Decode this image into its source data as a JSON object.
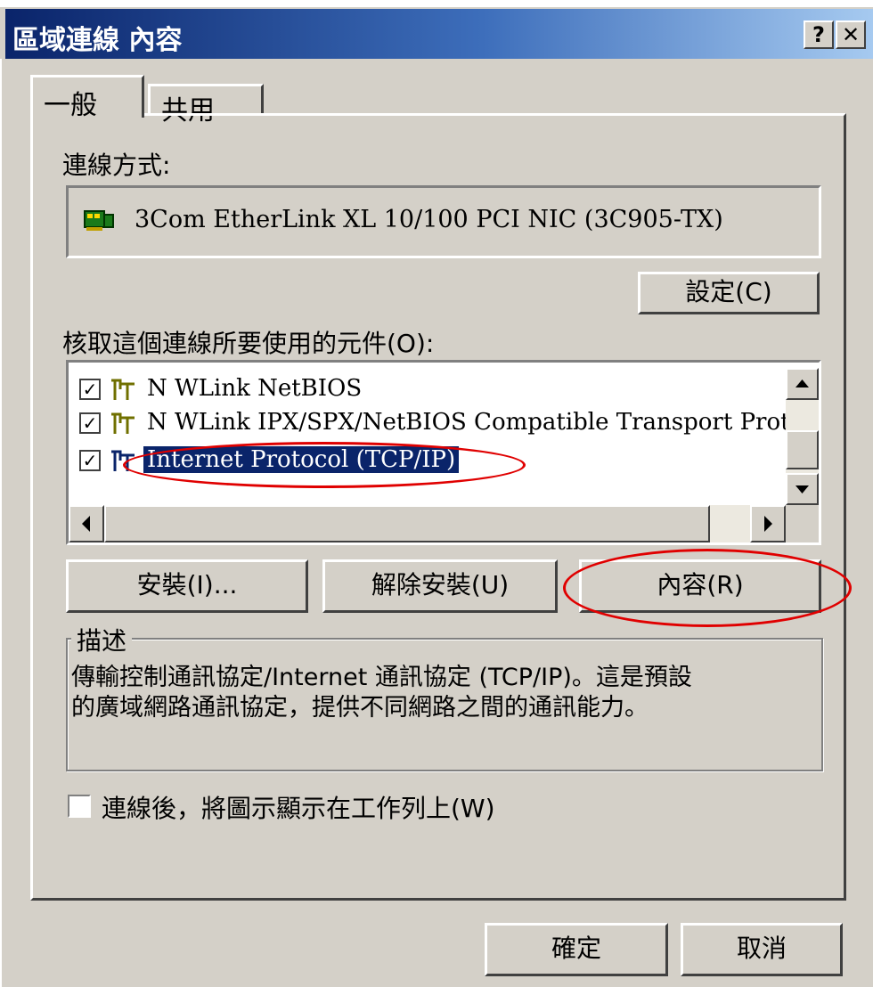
{
  "window": {
    "title": "區域連線 內容",
    "help_label": "?",
    "close_label": "✕"
  },
  "tabs": [
    {
      "label": "一般",
      "active": true
    },
    {
      "label": "共用",
      "active": false
    }
  ],
  "connect_using": {
    "label": "連線方式:",
    "adapter": "3Com EtherLink XL 10/100 PCI NIC (3C905-TX)",
    "configure_label": "設定(C)"
  },
  "components": {
    "label": "核取這個連線所要使用的元件(O):",
    "items": [
      {
        "label": "N WLink NetBIOS",
        "checked": true,
        "selected": false
      },
      {
        "label": "N WLink IPX/SPX/NetBIOS Compatible Transport Protoc",
        "checked": true,
        "selected": false
      },
      {
        "label": "Internet Protocol (TCP/IP)",
        "checked": true,
        "selected": true
      }
    ]
  },
  "buttons": {
    "install": "安裝(I)...",
    "uninstall": "解除安裝(U)",
    "properties": "內容(R)"
  },
  "description": {
    "legend": "描述",
    "line1": "傳輸控制通訊協定/Internet 通訊協定 (TCP/IP)。這是預設",
    "line2": "的廣域網路通訊協定，提供不同網路之間的通訊能力。"
  },
  "show_icon": {
    "label": "連線後，將圖示顯示在工作列上(W)",
    "checked": false
  },
  "footer": {
    "ok": "確定",
    "cancel": "取消"
  },
  "colors": {
    "annotation": "#e00000",
    "selection": "#0a246a",
    "titlebar": "#0a246a"
  }
}
